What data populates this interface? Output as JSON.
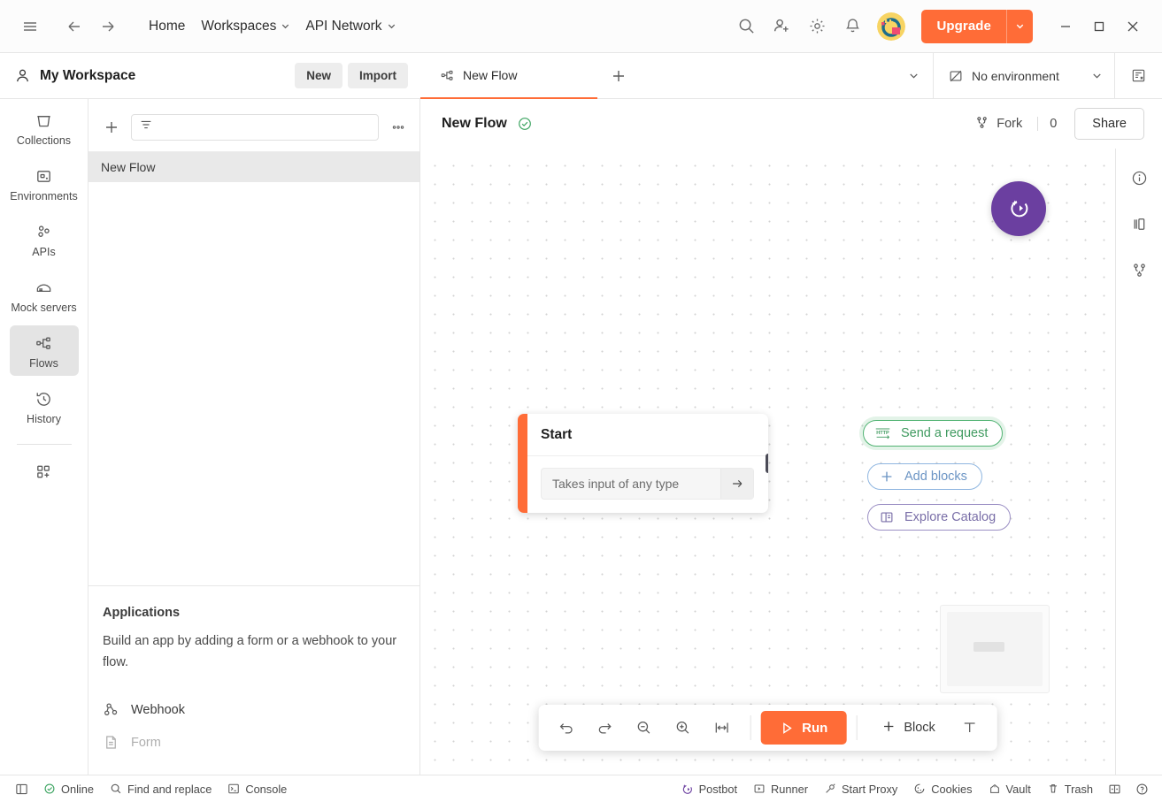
{
  "header": {
    "menu_icon": "hamburger-icon",
    "back_icon": "arrow-left-icon",
    "forward_icon": "arrow-right-icon",
    "home_label": "Home",
    "workspaces_label": "Workspaces",
    "api_network_label": "API Network",
    "search_icon": "search-icon",
    "invite_icon": "invite-user-icon",
    "settings_icon": "gear-icon",
    "notifications_icon": "bell-icon",
    "avatar_icon": "user-avatar",
    "upgrade_label": "Upgrade",
    "minimize_icon": "minimize-icon",
    "maximize_icon": "maximize-icon",
    "close_icon": "close-icon"
  },
  "workspace": {
    "name": "My Workspace",
    "user_icon": "person-icon",
    "new_label": "New",
    "import_label": "Import"
  },
  "sidebar": {
    "items": [
      {
        "label": "Collections",
        "icon": "collections-icon",
        "active": false
      },
      {
        "label": "Environments",
        "icon": "environments-icon",
        "active": false
      },
      {
        "label": "APIs",
        "icon": "apis-icon",
        "active": false
      },
      {
        "label": "Mock servers",
        "icon": "mock-servers-icon",
        "active": false
      },
      {
        "label": "Flows",
        "icon": "flows-icon",
        "active": true
      },
      {
        "label": "History",
        "icon": "history-icon",
        "active": false
      }
    ],
    "add_module_icon": "add-module-icon"
  },
  "explorer": {
    "new_icon": "plus-icon",
    "filter_icon": "filter-icon",
    "filter_placeholder": "",
    "filter_value": "",
    "more_icon": "more-horizontal-icon",
    "flows": [
      {
        "name": "New Flow",
        "selected": true
      }
    ],
    "applications": {
      "title": "Applications",
      "description": "Build an app by adding a form or a webhook to your flow.",
      "items": [
        {
          "label": "Webhook",
          "icon": "webhook-icon",
          "disabled": false
        },
        {
          "label": "Form",
          "icon": "form-icon",
          "disabled": true
        }
      ]
    }
  },
  "tabs": {
    "open": [
      {
        "label": "New Flow",
        "icon": "flows-icon",
        "active": true
      }
    ],
    "add_tab_icon": "plus-icon",
    "tabs_caret_icon": "chevron-down-icon",
    "environment_label": "No environment",
    "environment_icon": "no-environment-icon",
    "environment_caret_icon": "chevron-down-icon",
    "env_quick_look_icon": "environment-quick-look-icon"
  },
  "flow_header": {
    "title": "New Flow",
    "saved_icon": "check-circle-icon",
    "fork_label": "Fork",
    "fork_icon": "fork-icon",
    "fork_count": "0",
    "share_label": "Share"
  },
  "canvas": {
    "start_node": {
      "title": "Start",
      "input_placeholder": "Takes input of any type",
      "arrow_icon": "arrow-right-icon",
      "accent_color": "#ff6c37"
    },
    "suggestions": [
      {
        "label": "Send a request",
        "icon": "http-icon",
        "color": "#51b373",
        "style": "green"
      },
      {
        "label": "Add blocks",
        "icon": "plus-icon",
        "color": "#8fb6e0",
        "style": "blue"
      },
      {
        "label": "Explore Catalog",
        "icon": "catalog-icon",
        "color": "#9b8fc4",
        "style": "purple"
      }
    ],
    "postbot_fab_icon": "postbot-icon",
    "minimap_icon": "minimap"
  },
  "canvas_toolbar": {
    "undo_icon": "undo-icon",
    "redo_icon": "redo-icon",
    "zoom_out_icon": "zoom-out-icon",
    "zoom_in_icon": "zoom-in-icon",
    "fit_screen_icon": "fit-to-screen-icon",
    "run_label": "Run",
    "run_icon": "play-icon",
    "block_label": "Block",
    "block_icon": "plus-icon",
    "text_tool_icon": "text-tool-icon"
  },
  "right_rail": {
    "items": [
      {
        "icon": "info-circle-icon"
      },
      {
        "icon": "documentation-icon"
      },
      {
        "icon": "fork-icon"
      }
    ]
  },
  "statusbar": {
    "left": [
      {
        "label": "",
        "icon": "sidebar-toggle-icon"
      },
      {
        "label": "Online",
        "icon": "online-icon"
      },
      {
        "label": "Find and replace",
        "icon": "search-icon"
      },
      {
        "label": "Console",
        "icon": "console-icon"
      }
    ],
    "right": [
      {
        "label": "Postbot",
        "icon": "postbot-icon"
      },
      {
        "label": "Runner",
        "icon": "runner-icon"
      },
      {
        "label": "Start Proxy",
        "icon": "proxy-icon"
      },
      {
        "label": "Cookies",
        "icon": "cookies-icon"
      },
      {
        "label": "Vault",
        "icon": "vault-icon"
      },
      {
        "label": "Trash",
        "icon": "trash-icon"
      },
      {
        "label": "",
        "icon": "layout-icon"
      },
      {
        "label": "",
        "icon": "help-icon"
      }
    ]
  },
  "colors": {
    "brand_orange": "#ff6c37",
    "postbot_purple": "#6b3fa0",
    "success_green": "#3aa35f"
  }
}
